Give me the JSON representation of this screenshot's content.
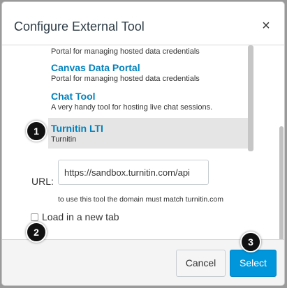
{
  "dialog": {
    "title": "Configure External Tool",
    "close_glyph": "×"
  },
  "tools": [
    {
      "name": "",
      "description": "Portal for managing hosted data credentials",
      "selected": false
    },
    {
      "name": "Canvas Data Portal",
      "description": "Portal for managing hosted data credentials",
      "selected": false
    },
    {
      "name": "Chat Tool",
      "description": "A very handy tool for hosting live chat sessions.",
      "selected": false
    },
    {
      "name": "Turnitin LTI",
      "description": "Turnitin",
      "selected": true
    }
  ],
  "url": {
    "label": "URL:",
    "value": "https://sandbox.turnitin.com/api",
    "hint": "to use this tool the domain must match turnitin.com"
  },
  "new_tab": {
    "label": "Load in a new tab",
    "checked": false
  },
  "footer": {
    "cancel_label": "Cancel",
    "select_label": "Select"
  },
  "callouts": [
    "1",
    "2",
    "3"
  ],
  "colors": {
    "link": "#0081bd",
    "primary_button": "#0096db",
    "selected_row": "#e5e5e5"
  }
}
